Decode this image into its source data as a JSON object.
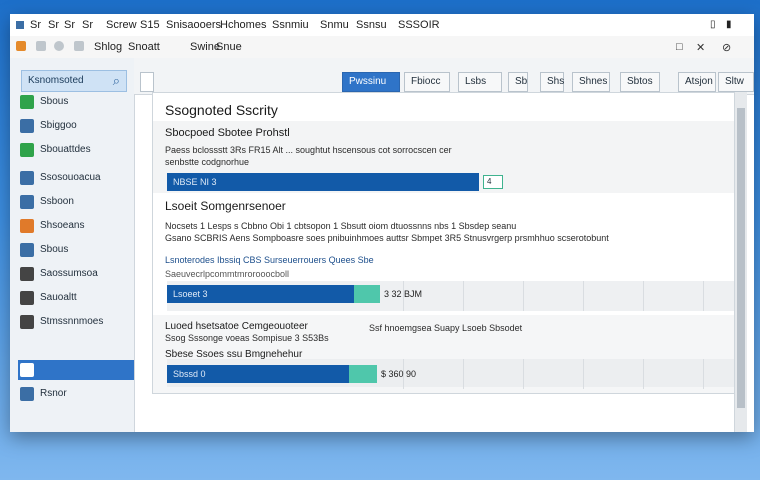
{
  "menubar": {
    "items": [
      "Sr",
      "Sr",
      "Sr",
      "Sr",
      "Screw",
      "S15",
      "Snisaooers",
      "Hchomes",
      "Ssnmiu",
      "Snmu",
      "Ssnsu",
      "SSSOIR"
    ]
  },
  "toolbar": {
    "items": [
      "Shlog",
      "Snoatt",
      "Swine",
      "Snue"
    ],
    "window_controls": [
      "□",
      "✕",
      "⊘"
    ]
  },
  "sidebar": {
    "search_label": "Ksnomsoted",
    "items": [
      {
        "label": "Sbous",
        "color": "#2fa34a"
      },
      {
        "label": "Sbiggoo",
        "color": "#3b6ea5"
      },
      {
        "label": "Sbouattdes",
        "color": "#2fa34a"
      },
      {
        "label": "Ssosouoacua",
        "color": "#3b6ea5"
      },
      {
        "label": "Ssboon",
        "color": "#3b6ea5"
      },
      {
        "label": "Shsoeans",
        "color": "#e07a2a"
      },
      {
        "label": "Sbous",
        "color": "#3b6ea5"
      },
      {
        "label": "Saossumsoa",
        "color": "#444444"
      },
      {
        "label": "Sauoaltt",
        "color": "#444444"
      },
      {
        "label": "Stmssnnmoes",
        "color": "#444444"
      },
      {
        "label": "",
        "color": "#ffffff",
        "selected": true
      },
      {
        "label": "Rsnor",
        "color": "#3b6ea5"
      }
    ]
  },
  "topbar": {
    "buttons": [
      {
        "label": "Pwssinu",
        "primary": true
      },
      {
        "label": "Fbiocc"
      },
      {
        "label": "Lsbs"
      },
      {
        "label": "Sb"
      },
      {
        "label": "Shs"
      },
      {
        "label": "Shnes"
      },
      {
        "label": "Sbtos"
      },
      {
        "label": "Atsjon"
      },
      {
        "label": "Sltw"
      }
    ]
  },
  "content": {
    "page_title": "Ssognoted Sscrity",
    "header_text": "Sbocpoed Sbotee Prohstl",
    "section1": {
      "desc_line1": "Paess bclossstt 3Rs  FR15  Alt  ...  soughtut hscensous  cot  sorrocscen  cer",
      "desc_line2": "senbstte codgnorhue",
      "bar_label": "NBSE NI 3",
      "chip_label": "4",
      "value": 0.55
    },
    "section2": {
      "title": "Lsoeit Somgenrsenoer",
      "desc_line1": "Nocsets 1 Lesps s Cbbno Obi  1 cbtsopon 1 Sbsutt  oiom dtuossnns  nbs  1 Sbsdep  seanu",
      "desc_line2": "Gsano SCBRIS Aens Sompboasre  soes pnibuinhmoes auttsr Sbmpet 3R5  Stnusvrgerp prsmhhuo scserotobunt",
      "legend": "Lsnoterodes  Ibssiq CBS Surseuerrouers  Quees  Sbe",
      "sublabel": "Saeuvecrlpcommtmrorooocboll",
      "bar_label": "Lsoeet 3",
      "bar_value_label": "3 32 BJM",
      "value": 0.33
    },
    "section3": {
      "desc_line1": "Luoed hsetsatoe Cemgeouoteer",
      "desc_line1b": "Ssf hnoemgsea  Suapy  Lsoeb Sbsodet",
      "desc_line2": "Ssog Sssonge voeas Sompisue 3 S53Bs",
      "sub": "Sbese Ssoes ssu  Bmgnehehur",
      "bar_label": "Sbssd 0",
      "bar_value_label": "$ 360 90",
      "value": 0.32
    }
  }
}
